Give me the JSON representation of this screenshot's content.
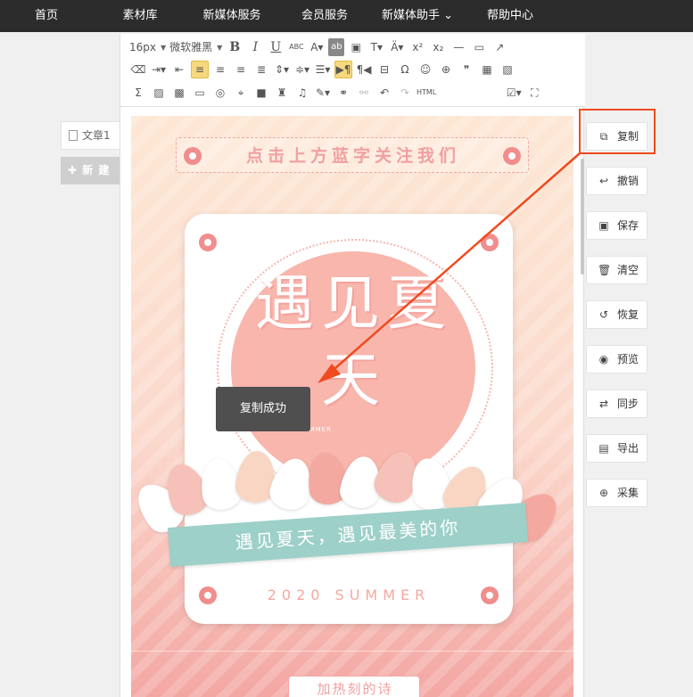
{
  "nav": {
    "items": [
      {
        "label": "首页"
      },
      {
        "label": "素材库"
      },
      {
        "label": "新媒体服务"
      },
      {
        "label": "会员服务"
      },
      {
        "label": "新媒体助手 ⌄"
      },
      {
        "label": "帮助中心"
      }
    ]
  },
  "sidebar": {
    "doc_tab": "文章1",
    "new_button": "✚ 新 建"
  },
  "toolbar": {
    "font_size": "16px",
    "font_family": "微软雅黑",
    "html_label": "HTML"
  },
  "poster": {
    "top_banner": "点击上方蓝字关注我们",
    "title": "遇见夏天",
    "summer_small": "SUMMER",
    "ribbon": "遇见夏天，遇见最美的你",
    "year_line": "2020 SUMMER",
    "next_banner": "加热刻的诗"
  },
  "toast": "复制成功",
  "actions": [
    {
      "label": "复制",
      "icon": "copy-icon"
    },
    {
      "label": "撤销",
      "icon": "undo-icon"
    },
    {
      "label": "保存",
      "icon": "save-icon"
    },
    {
      "label": "清空",
      "icon": "trash-icon"
    },
    {
      "label": "恢复",
      "icon": "restore-icon"
    },
    {
      "label": "预览",
      "icon": "eye-icon"
    },
    {
      "label": "同步",
      "icon": "sync-icon"
    },
    {
      "label": "导出",
      "icon": "export-icon"
    },
    {
      "label": "采集",
      "icon": "collect-icon"
    }
  ],
  "colors": {
    "nav_bg": "#2c2c2c",
    "highlight": "#f04a1e",
    "poster_pink": "#f8b6ad",
    "ribbon_teal": "#9dd0c8"
  }
}
